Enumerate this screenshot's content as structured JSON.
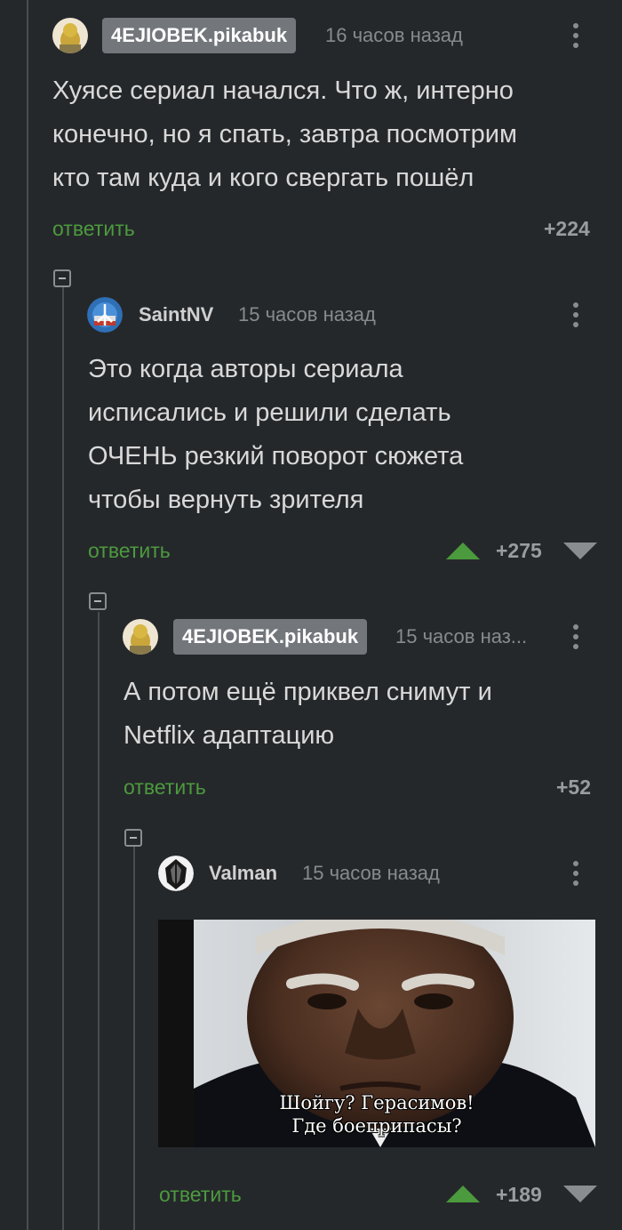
{
  "comments": [
    {
      "author": "4EJIOBEK.pikabuk",
      "time": "16 часов назад",
      "text_lines": [
        "Хуясе сериал начался. Что ж, интерно",
        "конечно, но я спать, завтра посмотрим",
        "кто там куда и кого свергать пошёл"
      ],
      "reply_label": "ответить",
      "rating": "+224"
    },
    {
      "author": "SaintNV",
      "time": "15 часов назад",
      "text_lines": [
        "Это когда авторы сериала",
        "исписались и решили сделать",
        "ОЧЕНЬ резкий поворот сюжета",
        "чтобы вернуть зрителя"
      ],
      "reply_label": "ответить",
      "rating": "+275"
    },
    {
      "author": "4EJIOBEK.pikabuk",
      "time": "15 часов наз...",
      "text_lines": [
        "А потом ещё приквел снимут и",
        "Netflix адаптацию"
      ],
      "reply_label": "ответить",
      "rating": "+52"
    },
    {
      "author": "Valman",
      "time": "15 часов назад",
      "meme_caption_lines": [
        "Шойгу? Герасимов!",
        "Где боеприпасы?"
      ],
      "reply_label": "ответить",
      "rating": "+189"
    }
  ],
  "colors": {
    "background": "#25282b",
    "reply_green": "#4c9a3e",
    "badge_grey": "#73777c"
  },
  "icons": [
    "collapse-icon",
    "kebab-menu-icon",
    "upvote-arrow-icon",
    "downvote-arrow-icon"
  ]
}
